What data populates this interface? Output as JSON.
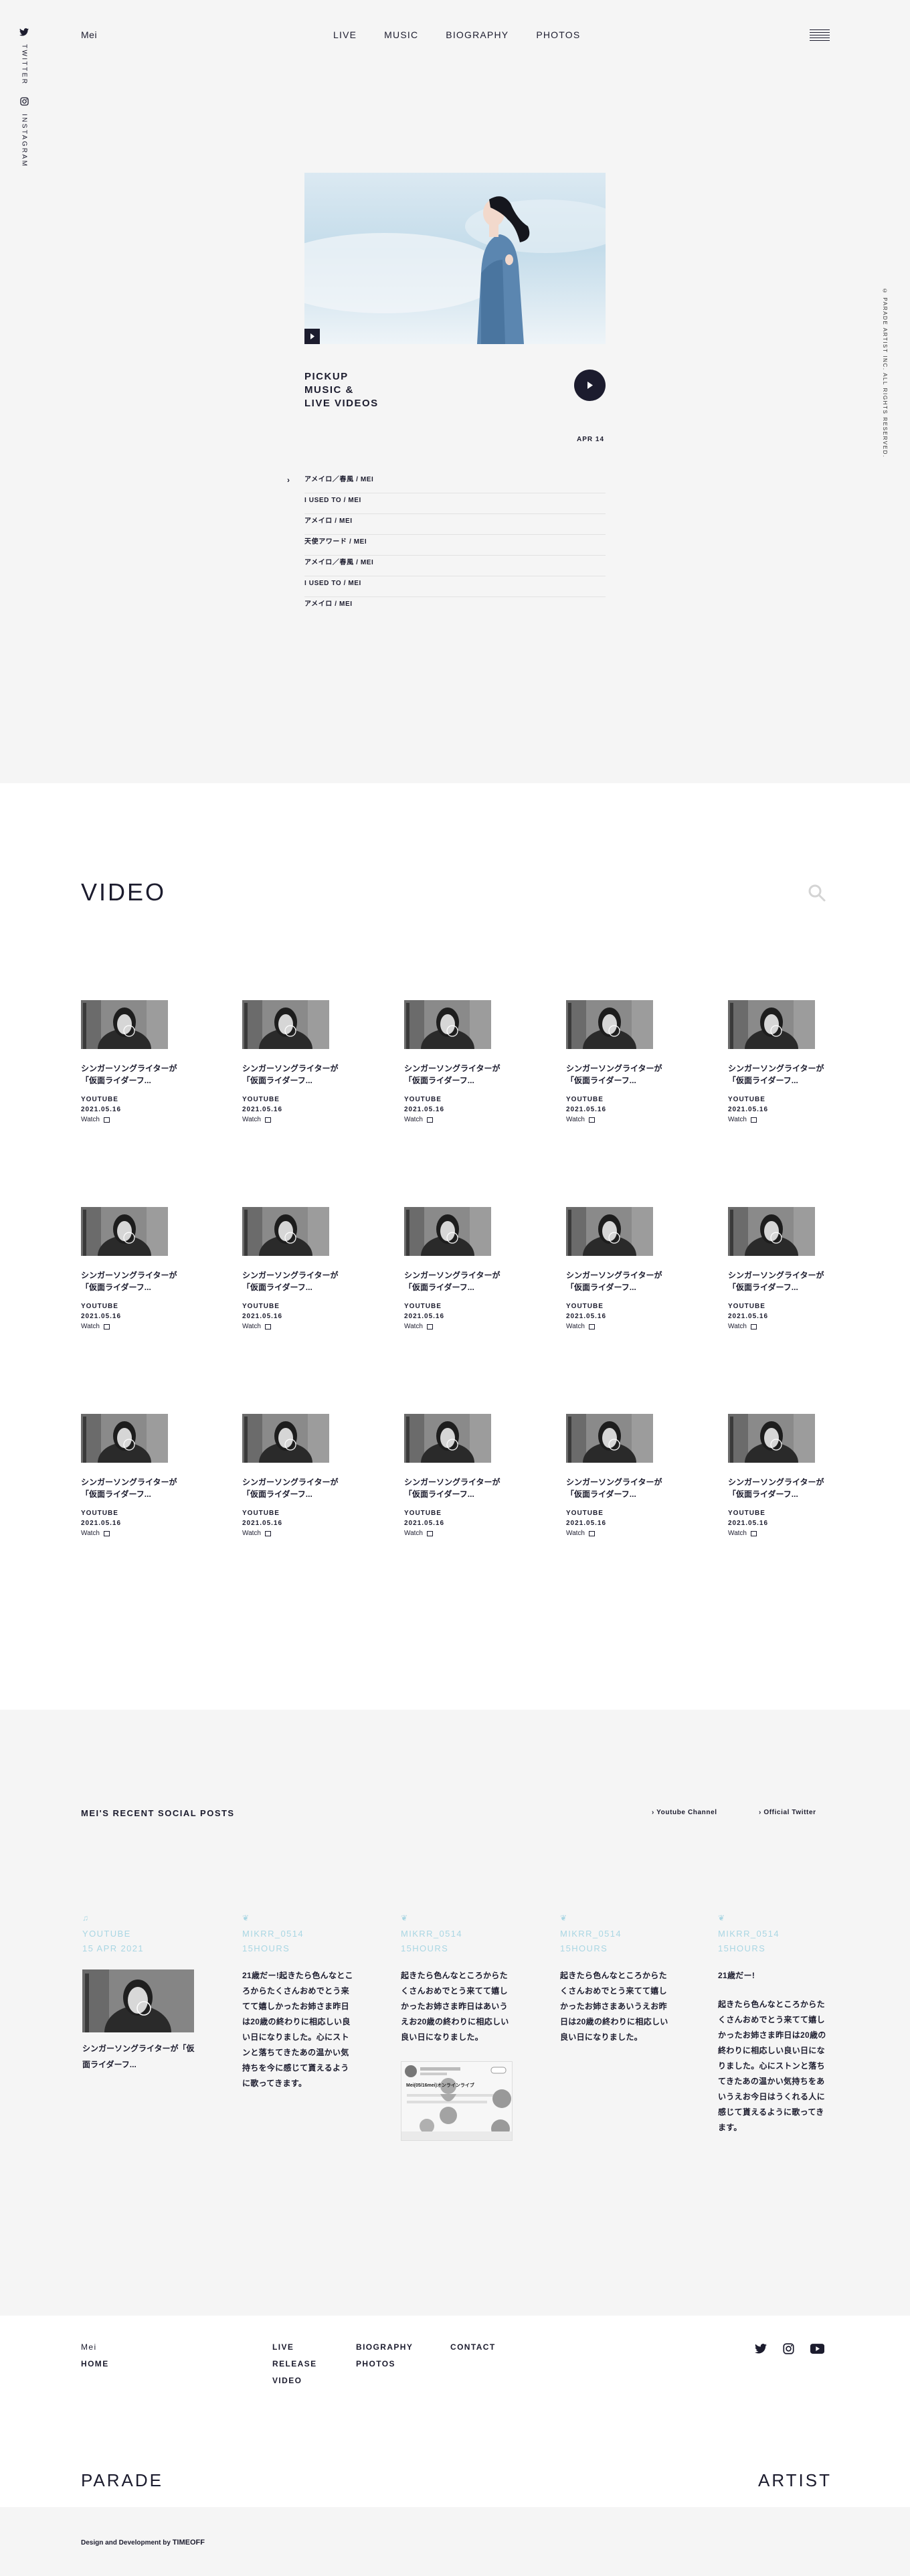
{
  "header": {
    "brand": "Mei",
    "nav": [
      "LIVE",
      "MUSIC",
      "BIOGRAPHY",
      "PHOTOS"
    ],
    "side_links": [
      "TWITTER",
      "INSTAGRAM"
    ],
    "copyright": "© PARADE ARTIST INC. ALL RIGHTS RESERVED."
  },
  "hero": {
    "pickup_lines": [
      "PICKUP",
      "MUSIC &",
      "LIVE VIDEOS"
    ],
    "date": "APR 14",
    "tracks": [
      "アメイロ／春風 / MEI",
      "I USED TO / MEI",
      "アメイロ / MEI",
      "天使アワード / MEI",
      "アメイロ／春風 / MEI",
      "I USED TO / MEI",
      "アメイロ / MEI"
    ]
  },
  "video_section": {
    "title": "VIDEO",
    "card": {
      "title": "シンガーソングライターが「仮面ライダーフ...",
      "source": "YOUTUBE",
      "date": "2021.05.16",
      "watch": "Watch"
    }
  },
  "social": {
    "title": "MEI'S RECENT SOCIAL POSTS",
    "links": [
      "Youtube Channel",
      "Official Twitter"
    ],
    "posts": [
      {
        "platform": "YOUTUBE",
        "when": "15 APR 2021",
        "caption": "シンガーソングライターが「仮面ライダーフ..."
      },
      {
        "handle": "MIKRR_0514",
        "when": "15HOURS",
        "body": "21歳だー!起きたら色んなところからたくさんおめでとう来てて嬉しかったお姉さま昨日は20歳の終わりに相応しい良い日になりました。心にストンと落ちてきたあの温かい気持ちを今に感じて貰えるように歌ってきます。"
      },
      {
        "handle": "MIKRR_0514",
        "when": "15HOURS",
        "body": "起きたら色んなところからたくさんおめでとう来てて嬉しかったお姉さま昨日はあいうえお20歳の終わりに相応しい良い日になりました。",
        "tweet_text": "Mei(05/16mei)オンラインライブ"
      },
      {
        "handle": "MIKRR_0514",
        "when": "15HOURS",
        "body": "起きたら色んなところからたくさんおめでとう来てて嬉しかったお姉さまあいうえお昨日は20歳の終わりに相応しい良い日になりました。"
      },
      {
        "handle": "MIKRR_0514",
        "when": "15HOURS",
        "body_title": "21歳だー!",
        "body": "起きたら色んなところからたくさんおめでとう来てて嬉しかったお姉さま昨日は20歳の終わりに相応しい良い日になりました。心にストンと落ちてきたあの温かい気持ちをあいうえお今日はうくれる人に感じて貰えるように歌ってきます。"
      }
    ]
  },
  "footer": {
    "col1": [
      "Mei",
      "HOME"
    ],
    "col2": [
      "LIVE",
      "RELEASE",
      "VIDEO"
    ],
    "col3": [
      "BIOGRAPHY",
      "PHOTOS"
    ],
    "col4": [
      "CONTACT"
    ],
    "brand_left": "PARADE",
    "brand_right": "ARTIST",
    "credit_prefix": "Design and Development by",
    "credit_name": "TIMEOFF"
  },
  "icons": {
    "twitter": "twitter-icon",
    "instagram": "instagram-icon",
    "youtube": "youtube-icon",
    "search": "search-icon",
    "play": "play-icon",
    "hamburger": "hamburger-icon"
  }
}
